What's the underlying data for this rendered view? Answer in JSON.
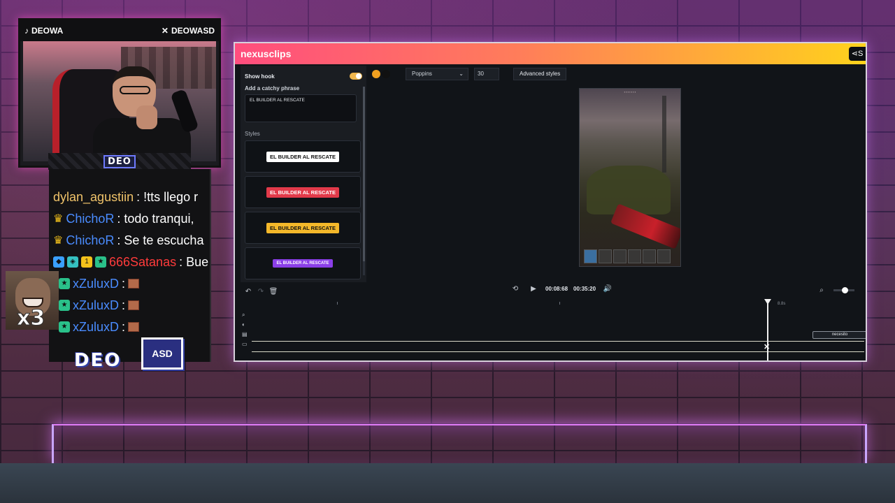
{
  "stream": {
    "tiktok_handle": "DEOWA",
    "x_handle": "DEOWASD",
    "cam_logo": "DEO",
    "bottom_logo_main": "DEO",
    "bottom_logo_small": "ASD",
    "emote_count": "x3"
  },
  "chat": {
    "messages": [
      {
        "user": "dylan_agustiin",
        "text": ": !tts llego r",
        "color": "#f0c36a",
        "badges": ""
      },
      {
        "user": "ChichoR",
        "text": ": todo tranqui,",
        "color": "#4a8cff",
        "badges": "crown"
      },
      {
        "user": "ChichoR",
        "text": ": Se te escucha",
        "color": "#4a8cff",
        "badges": "crown"
      },
      {
        "user": "666Satanas",
        "text": ": Bue",
        "color": "#ff3b3b",
        "badges": "multi"
      },
      {
        "user": "xZuluxD",
        "text": ":",
        "color": "#4a8cff",
        "badges": "sub"
      },
      {
        "user": "xZuluxD",
        "text": ":",
        "color": "#4a8cff",
        "badges": "sub"
      },
      {
        "user": "xZuluxD",
        "text": ":",
        "color": "#4a8cff",
        "badges": "sub"
      }
    ]
  },
  "app": {
    "brand": "nexusclips",
    "share_label": "S",
    "colors": {
      "header_start": "#ff4d7e",
      "header_end": "#ffd21c",
      "accent": "#f0b64c"
    },
    "toolbar": {
      "swatch_primary": "#f0a020",
      "swatch_secondary": "#111111",
      "font_family": "Poppins",
      "font_size": "30",
      "advanced_label": "Advanced styles"
    },
    "left_panel": {
      "show_hook_label": "Show hook",
      "show_hook_on": true,
      "catchy_label": "Add a catchy phrase",
      "catchy_value": "EL BUILDER AL RESCATE",
      "styles_label": "Styles",
      "styles": [
        {
          "text": "EL BUILDER AL RESCATE",
          "bg": "#ffffff",
          "fg": "#111111"
        },
        {
          "text": "EL BUILDER AL RESCATE",
          "bg": "#e23a4a",
          "fg": "#ffffff"
        },
        {
          "text": "EL BUILDER AL RESCATE",
          "bg": "#f4b82a",
          "fg": "#111111"
        },
        {
          "text": "EL BUILDER AL RESCATE",
          "bg": "#8b3fe8",
          "fg": "#ffffff"
        }
      ]
    },
    "transport": {
      "current_time": "00:08:68",
      "total_time": "00:35:20"
    },
    "timeline": {
      "playhead_label": "8.8s",
      "clip_label": "necesito"
    }
  }
}
